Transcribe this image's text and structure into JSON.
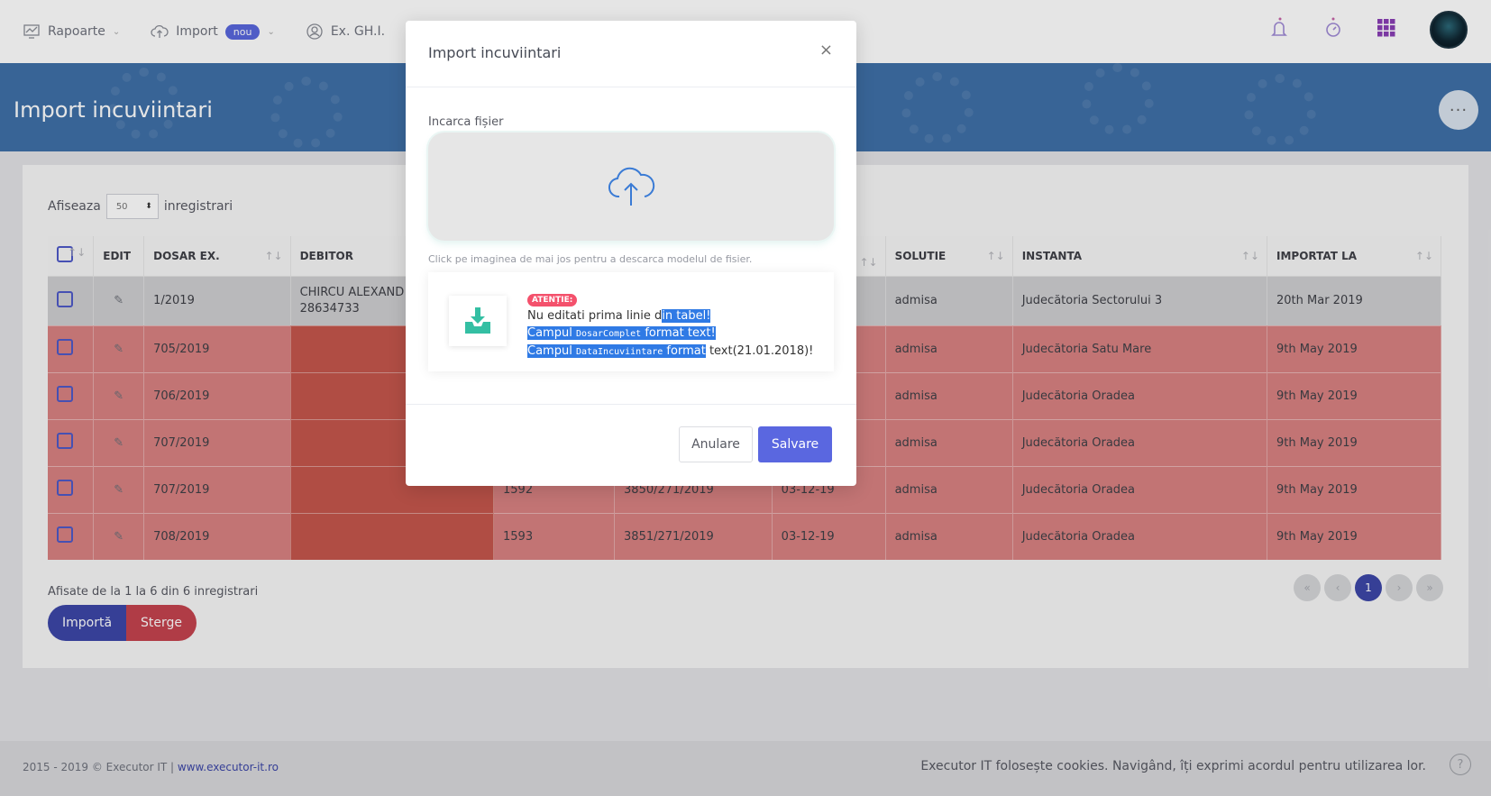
{
  "topnav": {
    "items": [
      {
        "label": "Rapoarte",
        "icon": "chart-icon"
      },
      {
        "label": "Import",
        "icon": "cloud-upload-icon",
        "badge": "nou"
      },
      {
        "label": "Ex. GH.I.",
        "icon": "user-circle-icon"
      }
    ]
  },
  "header": {
    "title": "Import incuviintari",
    "more": "···"
  },
  "list": {
    "show_prefix": "Afiseaza",
    "show_value": "50",
    "show_suffix": "inregistrari",
    "columns": [
      "EDIT",
      "DOSAR EX.",
      "DEBITOR",
      "",
      "",
      "",
      "SOLUTIE",
      "INSTANTA",
      "IMPORTAT LA"
    ],
    "rows": [
      {
        "dosar": "1/2019",
        "debitor": "CHIRCU ALEXAND",
        "debitor2": "28634733",
        "c4": "",
        "c5": "",
        "c6": "",
        "solutie": "admisa",
        "instanta": "Judecătoria Sectorului 3",
        "importat": "20th Mar 2019"
      },
      {
        "dosar": "705/2019",
        "debitor": "",
        "debitor2": "",
        "c4": "",
        "c5": "",
        "c6": "",
        "solutie": "admisa",
        "instanta": "Judecătoria Satu Mare",
        "importat": "9th May 2019"
      },
      {
        "dosar": "706/2019",
        "debitor": "",
        "debitor2": "",
        "c4": "",
        "c5": "",
        "c6": "",
        "solutie": "admisa",
        "instanta": "Judecătoria Oradea",
        "importat": "9th May 2019"
      },
      {
        "dosar": "707/2019",
        "debitor": "",
        "debitor2": "",
        "c4": "",
        "c5": "",
        "c6": "",
        "solutie": "admisa",
        "instanta": "Judecătoria Oradea",
        "importat": "9th May 2019"
      },
      {
        "dosar": "707/2019",
        "debitor": "",
        "debitor2": "",
        "c4": "1592",
        "c5": "3850/271/2019",
        "c6": "03-12-19",
        "solutie": "admisa",
        "instanta": "Judecătoria Oradea",
        "importat": "9th May 2019"
      },
      {
        "dosar": "708/2019",
        "debitor": "",
        "debitor2": "",
        "c4": "1593",
        "c5": "3851/271/2019",
        "c6": "03-12-19",
        "solutie": "admisa",
        "instanta": "Judecătoria Oradea",
        "importat": "9th May 2019"
      }
    ],
    "info": "Afisate de la 1 la 6 din 6 inregistrari",
    "import_label": "Importă",
    "delete_label": "Sterge",
    "pager": {
      "first": "«",
      "prev": "‹",
      "current": "1",
      "next": "›",
      "last": "»"
    }
  },
  "footer": {
    "copyright": "2015 - 2019 © Executor IT | ",
    "link": "www.executor-it.ro",
    "cookies": "Executor IT folosește cookies. Navigând, îți exprimi acordul pentru utilizarea lor.",
    "help": "?"
  },
  "modal": {
    "title": "Import incuviintari",
    "close": "×",
    "upload_label": "Incarca fișier",
    "hint": "Click pe imaginea de mai jos pentru a descarca modelul de fisier.",
    "badge": "ATENȚIE:",
    "line1a": "Nu editati prima linie d",
    "line1b": "in tabel!",
    "line2a": "Campul",
    "line2code": "DosarComplet",
    "line2b": "format text!",
    "line3a": "Campul",
    "line3code": "DataIncuviintare",
    "line3b": "format",
    "line3c": "text(21.01.2018)!",
    "cancel": "Anulare",
    "save": "Salvare"
  },
  "colors": {
    "accent": "#5867dd",
    "danger": "#f4516c",
    "header_blue": "#3f70a8",
    "row_red": "#d98282"
  }
}
